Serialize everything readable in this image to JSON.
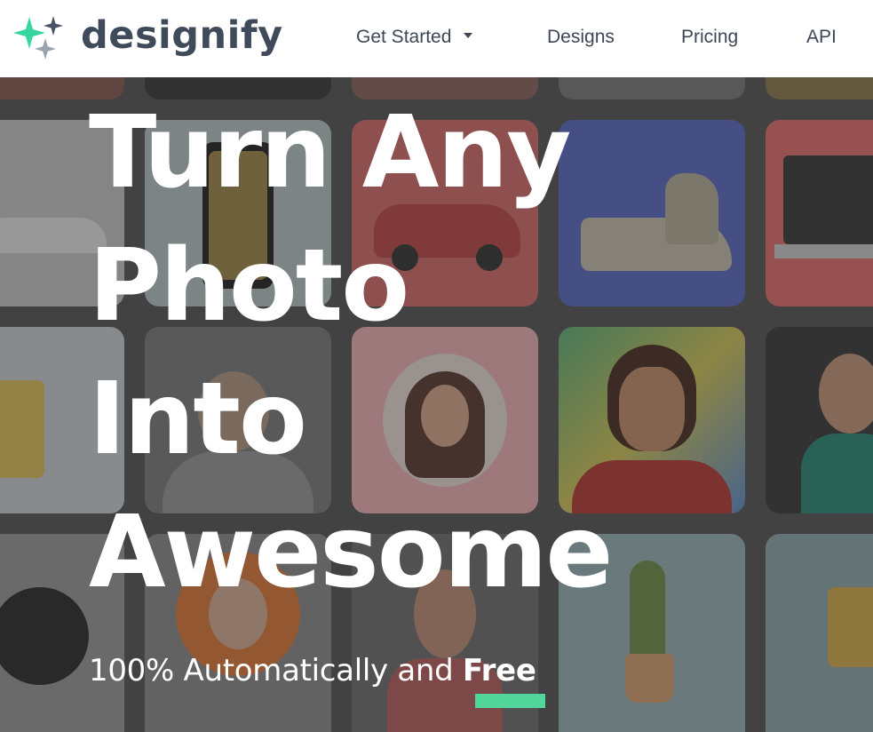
{
  "header": {
    "brand": "designify",
    "nav": {
      "get_started": "Get Started",
      "designs": "Designs",
      "pricing": "Pricing",
      "api": "API"
    }
  },
  "hero": {
    "headline": [
      "Turn Any",
      "Photo",
      "Into",
      "Awesome"
    ],
    "subline_plain": "100% Automatically and ",
    "subline_emphasis": "Free"
  },
  "colors": {
    "brand_text": "#3f4a5a",
    "logo_green": "#36d6a0",
    "logo_gray": "#9aa3ad",
    "accent_underline": "#52d69c"
  },
  "icons": [
    "sparkles-logo-icon",
    "chevron-down-icon"
  ]
}
